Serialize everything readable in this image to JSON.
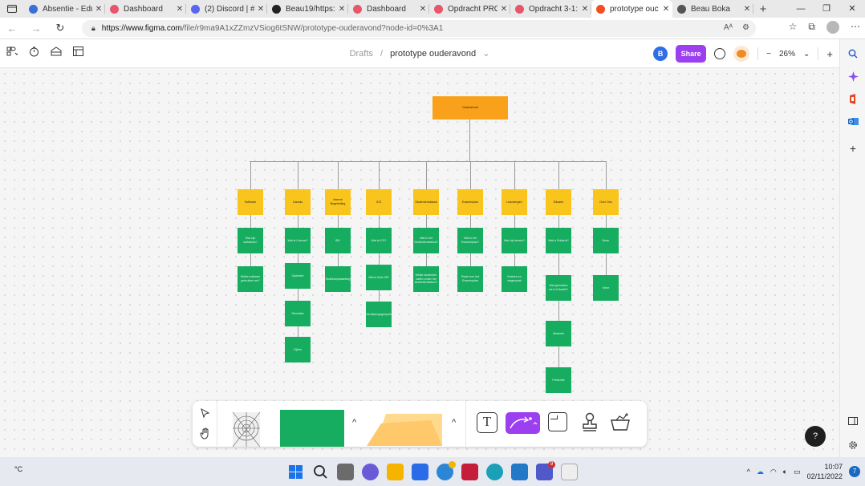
{
  "browser": {
    "tabs": [
      {
        "label": "Absentie - Edu",
        "color": "#3a6fd8"
      },
      {
        "label": "Dashboard",
        "color": "#e8566c"
      },
      {
        "label": "(2) Discord | #",
        "color": "#5865f2"
      },
      {
        "label": "Beau19/https:",
        "color": "#222222"
      },
      {
        "label": "Dashboard",
        "color": "#e8566c"
      },
      {
        "label": "Opdracht PRO",
        "color": "#e8566c"
      },
      {
        "label": "Opdracht 3-1:",
        "color": "#e8566c"
      },
      {
        "label": "prototype ouc",
        "color": "#f24e1e"
      },
      {
        "label": "Beau Boka",
        "color": "#555555"
      }
    ],
    "url_host": "https://www.figma.com",
    "url_path": "/file/r9ma9A1xZZmzVSiog6tSNW/prototype-ouderavond?node-id=0%3A1"
  },
  "figma": {
    "breadcrumb_root": "Drafts",
    "breadcrumb_sep": "/",
    "file_name": "prototype ouderavond",
    "user_initial": "B",
    "share_label": "Share",
    "zoom": "26%",
    "zoom_minus": "−",
    "zoom_plus": "+",
    "help_label": "?"
  },
  "diagram": {
    "root": "Ouderavond",
    "categories": [
      {
        "label": "Software",
        "children": [
          "Wat zijn softwares?",
          "Welke software gebruiken we?"
        ]
      },
      {
        "label": "Canvas",
        "children": [
          "Wat is Canvas?",
          "Opdracht",
          "Resultats",
          "Cijfers"
        ]
      },
      {
        "label": "Interne Begeleiding",
        "children": [
          "IBV",
          "Studieloopbaanbeg"
        ]
      },
      {
        "label": "ICS",
        "children": [
          "Wat is ICS?",
          "Wat is Kick-Off?",
          "Verdiepingsgesprek"
        ]
      },
      {
        "label": "Studentenstatuut",
        "children": [
          "Wat is het Studentenstatuut?",
          "Welke studenten vallen onder het studentenstatuut?"
        ]
      },
      {
        "label": "Examenplan",
        "children": [
          "Wat is het Examenplan?",
          "Praat over het Examenplan"
        ]
      },
      {
        "label": "Lesrotergen",
        "children": [
          "Wat zijn lessen?",
          "Kaarten en stagesprak"
        ]
      },
      {
        "label": "Eduarte",
        "children": [
          "Wat is Eduarte?",
          "Wat gebruiken we in Eduarte?",
          "Absentie",
          "Presentie"
        ]
      },
      {
        "label": "Over Ons",
        "children": [
          "Beau",
          "Seon"
        ]
      }
    ]
  },
  "taskbar": {
    "temp": "°C",
    "time": "10:07",
    "date": "02/11/2022",
    "notifications": "7",
    "teams_badge": "9"
  }
}
